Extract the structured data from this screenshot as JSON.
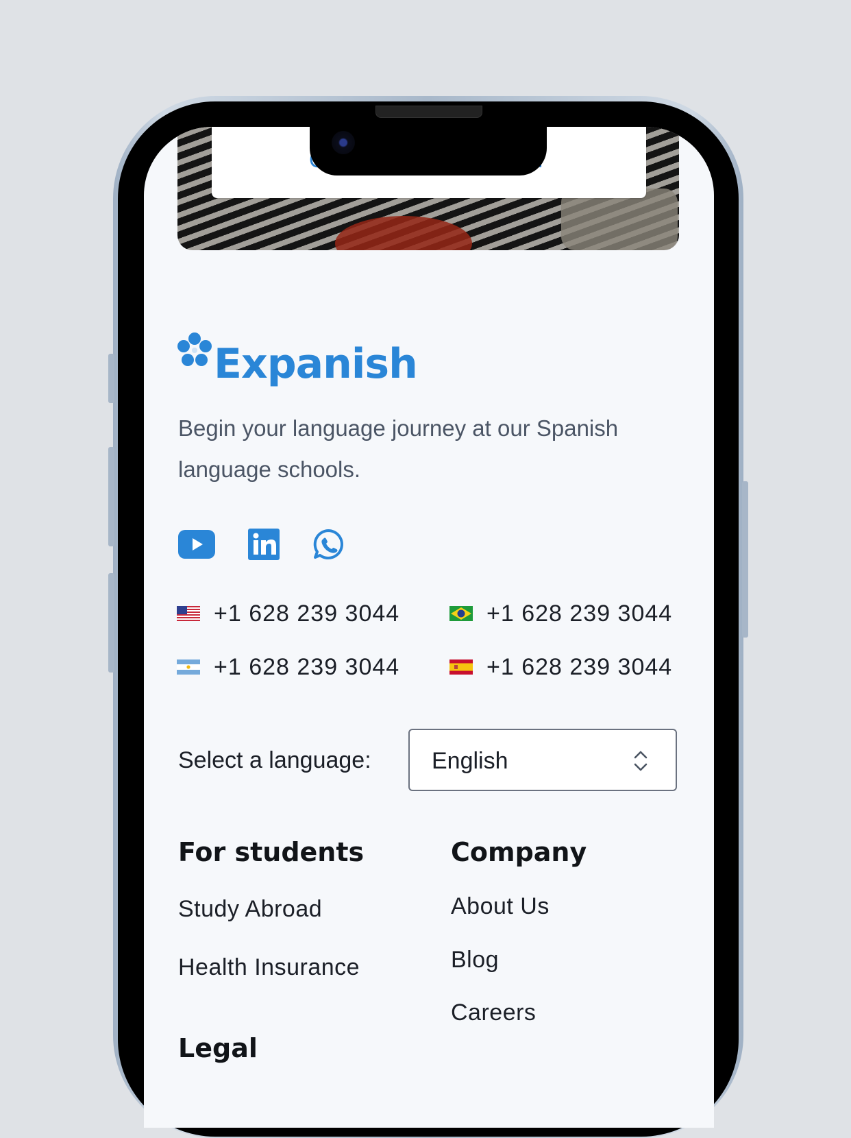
{
  "brand": {
    "name": "Expanish",
    "tagline": "Begin your language journey at our Spanish language schools.",
    "accent": "#2a86d7"
  },
  "socials": [
    {
      "icon": "youtube-icon"
    },
    {
      "icon": "linkedin-icon"
    },
    {
      "icon": "whatsapp-icon"
    }
  ],
  "phones": [
    {
      "flag": "us-flag-icon",
      "number": "+1 628 239 3044"
    },
    {
      "flag": "brazil-flag-icon",
      "number": "+1 628 239 3044"
    },
    {
      "flag": "argentina-flag-icon",
      "number": "+1 628 239 3044"
    },
    {
      "flag": "spain-flag-icon",
      "number": "+1 628 239 3044"
    }
  ],
  "language": {
    "label": "Select a language:",
    "selected": "English"
  },
  "footer": {
    "students": {
      "title": "For students",
      "links": [
        "Study Abroad",
        "Health Insurance"
      ]
    },
    "company": {
      "title": "Company",
      "links": [
        "About Us",
        "Blog",
        "Careers"
      ]
    },
    "legal": {
      "title": "Legal"
    }
  }
}
